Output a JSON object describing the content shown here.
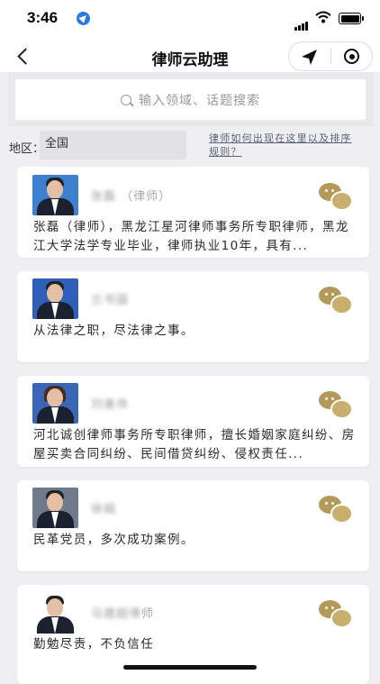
{
  "status_bar": {
    "time": "3:46"
  },
  "nav": {
    "title": "律师云助理"
  },
  "search": {
    "placeholder": "输入领域、话题搜索"
  },
  "filter": {
    "region_label": "地区：",
    "region_value": "全国",
    "rule_link": "律师如何出现在这里以及排序规则？"
  },
  "lawyers": [
    {
      "name": "张磊",
      "title": "（律师）",
      "bio": "张磊（律师），黑龙江星河律师事务所专职律师，黑龙江大学法学专业毕业，律师执业10年，具有...",
      "avatar_bg": "#3f7fcf"
    },
    {
      "name": "兰书国",
      "title": "",
      "bio": "从法律之职，尽法律之事。",
      "avatar_bg": "#2f5fb8"
    },
    {
      "name": "刘善伟",
      "title": "",
      "bio": "河北诚创律师事务所专职律师，擅长婚姻家庭纠纷、房屋买卖合同纠纷、民间借贷纠纷、侵权责任...",
      "avatar_bg": "#3a66b5"
    },
    {
      "name": "徐娟",
      "title": "",
      "bio": "民革党员，多次成功案例。",
      "avatar_bg": "#6f7b8c"
    },
    {
      "name": "马建超律",
      "title": "师",
      "bio": "勤勉尽责，不负信任",
      "avatar_bg": "#ffffff"
    }
  ],
  "colors": {
    "wechat_icon": "#b49a59",
    "link": "#5a6478",
    "background": "#efeff1"
  }
}
